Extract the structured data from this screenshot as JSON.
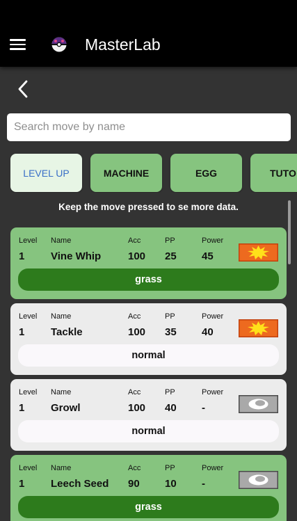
{
  "app": {
    "title": "MasterLab"
  },
  "search": {
    "placeholder": "Search move by name"
  },
  "tabs": [
    {
      "label": "LEVEL UP",
      "active": true
    },
    {
      "label": "MACHINE",
      "active": false
    },
    {
      "label": "EGG",
      "active": false
    },
    {
      "label": "TUTO",
      "active": false
    }
  ],
  "hint": "Keep the move pressed to se more data.",
  "columns": {
    "level": "Level",
    "name": "Name",
    "acc": "Acc",
    "pp": "PP",
    "power": "Power"
  },
  "moves": [
    {
      "level": "1",
      "name": "Vine Whip",
      "acc": "100",
      "pp": "25",
      "power": "45",
      "type": "grass",
      "category_icon": "physical-icon"
    },
    {
      "level": "1",
      "name": "Tackle",
      "acc": "100",
      "pp": "35",
      "power": "40",
      "type": "normal",
      "category_icon": "physical-icon"
    },
    {
      "level": "1",
      "name": "Growl",
      "acc": "100",
      "pp": "40",
      "power": "-",
      "type": "normal",
      "category_icon": "status-icon"
    },
    {
      "level": "1",
      "name": "Leech Seed",
      "acc": "90",
      "pp": "10",
      "power": "-",
      "type": "grass",
      "category_icon": "status-icon"
    }
  ],
  "colors": {
    "grass_card": "#86c47f",
    "grass_pill": "#2d7b1c",
    "normal_card": "#ececec",
    "active_tab_text": "#3a6fc7",
    "background": "#333333"
  }
}
